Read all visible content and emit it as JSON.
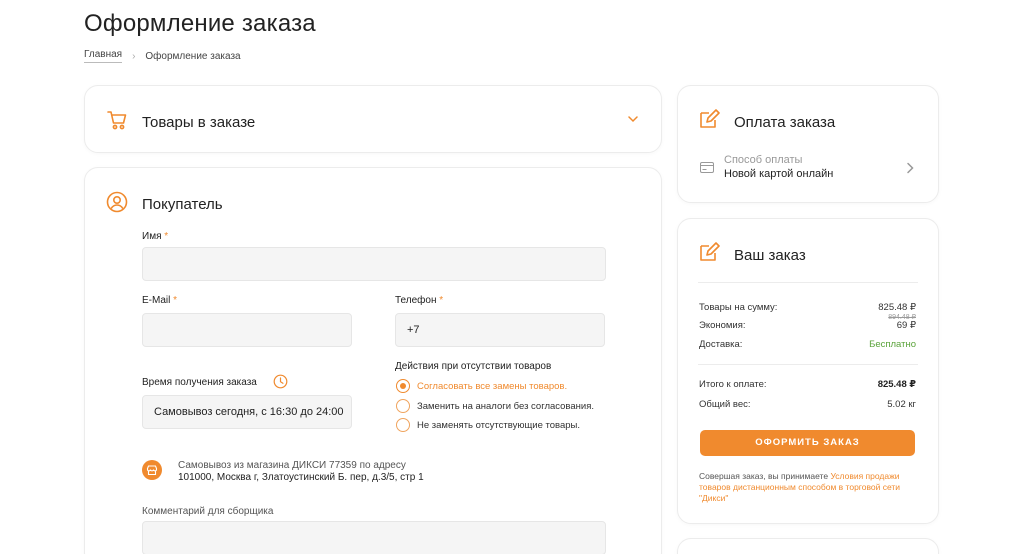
{
  "page": {
    "title": "Оформление заказа",
    "breadcrumb": [
      "Главная",
      "Оформление заказа"
    ]
  },
  "goods": {
    "title": "Товары в заказе"
  },
  "buyer": {
    "title": "Покупатель",
    "name_label": "Имя",
    "name_value": "",
    "email_label": "E-Mail",
    "email_value": "",
    "phone_label": "Телефон",
    "phone_value": "+7",
    "time_label": "Время получения заказа",
    "time_value": "Самовывоз сегодня, с 16:30 до 24:00",
    "actions_label": "Действия при отсутствии товаров",
    "actions": [
      {
        "label": "Согласовать все замены товаров.",
        "selected": true
      },
      {
        "label": "Заменить на аналоги без согласования.",
        "selected": false
      },
      {
        "label": "Не заменять отсутствующие товары.",
        "selected": false
      }
    ],
    "pickup_line1": "Самовывоз из магазина ДИКСИ 77359 по адресу",
    "pickup_line2": "101000, Москва г, Златоустинский Б. пер, д.3/5, стр 1",
    "comment_label": "Комментарий для сборщика",
    "comment_value": ""
  },
  "payment": {
    "title": "Оплата заказа",
    "method_label": "Способ оплаты",
    "method_value": "Новой картой онлайн"
  },
  "order": {
    "title": "Ваш заказ",
    "sum_label": "Товары на сумму:",
    "sum_value": "825.48 ₽",
    "sum_old": "894.48 ₽",
    "economy_label": "Экономия:",
    "economy_value": "69 ₽",
    "delivery_label": "Доставка:",
    "delivery_value": "Бесплатно",
    "total_label": "Итого к оплате:",
    "total_value": "825.48 ₽",
    "weight_label": "Общий вес:",
    "weight_value": "5.02 кг",
    "button_label": "ОФОРМИТЬ ЗАКАЗ",
    "terms_prefix": "Совершая заказ, вы принимаете ",
    "terms_link": "Условия продажи товаров дистанционным способом в торговой сети \"Дикси\""
  },
  "colors": {
    "accent": "#f08a2e",
    "free": "#5aa33a"
  }
}
